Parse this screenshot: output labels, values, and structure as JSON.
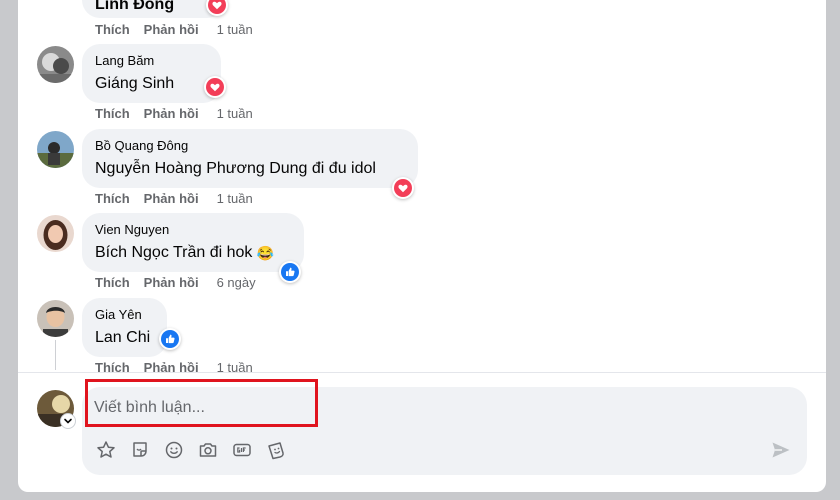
{
  "actions": {
    "like": "Thích",
    "reply": "Phản hồi"
  },
  "top_comment": {
    "text_partial": "Linh Đông",
    "time": "1 tuần"
  },
  "comments": [
    {
      "author": "Lang Băm",
      "mention": "Giáng Sinh",
      "rest": "",
      "reaction": "heart",
      "time": "1 tuần"
    },
    {
      "author": "Bồ Quang Đông",
      "mention": "Nguyễn Hoàng Phương Dung",
      "rest": " đi đu idol",
      "reaction": "heart",
      "time": "1 tuần"
    },
    {
      "author": "Vien Nguyen",
      "mention": "Bích Ngọc Trần",
      "rest": " đi hok",
      "emoji": "😂",
      "reaction": "like",
      "time": "6 ngày"
    },
    {
      "author": "Gia Yên",
      "mention": "Lan Chi",
      "rest": "",
      "reaction": "like",
      "time": "1 tuần"
    }
  ],
  "composer": {
    "placeholder": "Viết bình luận..."
  },
  "colors": {
    "heart": "#f33e58",
    "like": "#1877f2",
    "highlight": "#e0141e"
  },
  "icons": {
    "tools": [
      "avatar-sticker-icon",
      "sticker-icon",
      "emoji-icon",
      "camera-icon",
      "gif-icon",
      "sticker-alt-icon"
    ],
    "send": "send-icon"
  }
}
